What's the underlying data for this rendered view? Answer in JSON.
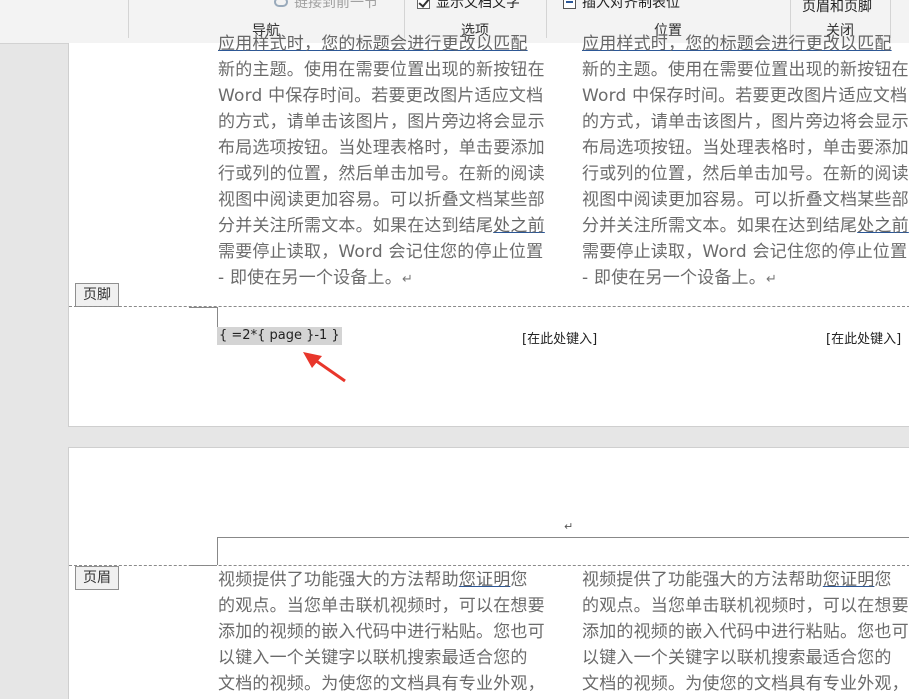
{
  "ribbon": {
    "groups": {
      "nav_label": "导航",
      "options_label": "选项",
      "position_label": "位置",
      "close_label": "关闭"
    },
    "items": {
      "link_prev": "链接到前一节",
      "show_doc_text": "显示文档文字",
      "insert_align_tab": "插入对齐制表位",
      "close_header_footer": "页眉和页脚"
    }
  },
  "page1": {
    "col_text_lines": [
      "应用样式时，您的标题会进行更改以匹配",
      "新的主题。使用在需要位置出现的新按钮在",
      "Word 中保存时间。若要更改图片适应文档",
      "的方式，请单击该图片，图片旁边将会显示",
      "布局选项按钮。当处理表格时，单击要添加",
      "行或列的位置，然后单击加号。在新的阅读",
      "视图中阅读更加容易。可以折叠文档某些部",
      "分并关注所需文本。如果在达到结尾",
      "处之前",
      "需要停止读取，Word 会记住您的停止位置",
      "- 即使在另一个设备上。"
    ],
    "return_mark": "↵",
    "footer_tag": "页脚",
    "footer_field": "{ =2*{ page }-1 }",
    "footer_placeholder_center": "[在此处键入]",
    "footer_placeholder_right": "[在此处键入]"
  },
  "page2": {
    "header_tag": "页眉",
    "header_return_mark": "↵",
    "col_text_lines": [
      "视频提供了功能强大的方法帮助",
      "您证明",
      "您",
      "的观点。当您单击联机视频时，可以在想要",
      "添加的视频的嵌入代码中进行粘贴。您也可",
      "以键入一个关键字以联机搜索最适合您的",
      "文档的视频。为使您的文档具有专业外观，"
    ]
  },
  "icons": {
    "link": "link-icon",
    "checkbox": "checkbox-checked-icon",
    "tab": "align-tab-icon",
    "arrow": "red-arrow-annotation"
  },
  "colors": {
    "annotation_arrow": "#e8362b",
    "field_shading": "#d4d4d4"
  }
}
